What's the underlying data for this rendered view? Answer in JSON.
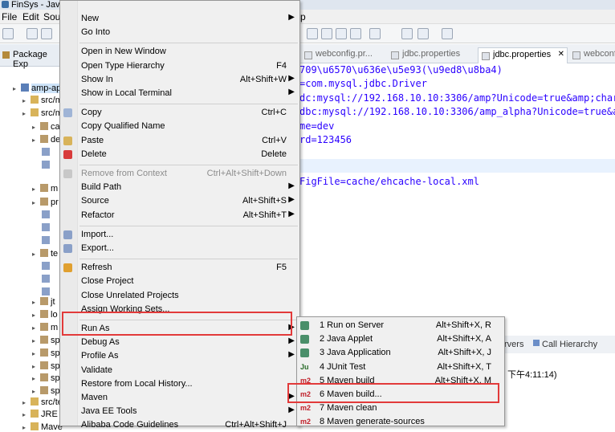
{
  "window": {
    "title": "FinSys - Java"
  },
  "menubar": {
    "file": "File",
    "edit": "Edit",
    "source": "Sou"
  },
  "package_explorer": {
    "title": "Package Exp",
    "items": [
      {
        "label": "amp-api",
        "indent": 0
      },
      {
        "label": "src/m",
        "indent": 1
      },
      {
        "label": "src/m",
        "indent": 1
      },
      {
        "label": "ca",
        "indent": 2
      },
      {
        "label": "de",
        "indent": 2
      },
      {
        "label": "",
        "indent": 3
      },
      {
        "label": "",
        "indent": 3
      },
      {
        "label": "m",
        "indent": 2
      },
      {
        "label": "pr",
        "indent": 2
      },
      {
        "label": "",
        "indent": 3
      },
      {
        "label": "",
        "indent": 3
      },
      {
        "label": "",
        "indent": 3
      },
      {
        "label": "te",
        "indent": 2
      },
      {
        "label": "",
        "indent": 3
      },
      {
        "label": "",
        "indent": 3
      },
      {
        "label": "",
        "indent": 3
      },
      {
        "label": "jt",
        "indent": 2
      },
      {
        "label": "lo",
        "indent": 2
      },
      {
        "label": "m",
        "indent": 2
      },
      {
        "label": "sp",
        "indent": 2
      },
      {
        "label": "sp",
        "indent": 2
      },
      {
        "label": "sp",
        "indent": 2
      },
      {
        "label": "sp",
        "indent": 2
      },
      {
        "label": "sp",
        "indent": 2
      },
      {
        "label": "src/te",
        "indent": 1
      },
      {
        "label": "JRE S",
        "indent": 1
      },
      {
        "label": "Mave",
        "indent": 1
      }
    ]
  },
  "editor": {
    "title_suffix": "p",
    "tabs": [
      {
        "label": "webconfig.pr...",
        "active": false
      },
      {
        "label": "jdbc.properties",
        "active": false
      },
      {
        "label": "jdbc.properties",
        "active": true,
        "close": "✕"
      },
      {
        "label": "webconfig",
        "active": false
      }
    ],
    "lines": [
      "709\\u6570\\u636e\\u5e93(\\u9ed8\\u8ba4)",
      "=com.mysql.jdbc.Driver",
      "dc:mysql://192.168.10.10:3306/amp?Unicode=true&amp;chara",
      "dbc:mysql://192.168.10.10:3306/amp_alpha?Unicode=true&am",
      "me=dev",
      "rd=123456",
      "",
      "",
      "FigFile=cache/ehcache-local.xml"
    ]
  },
  "bottom_panel": {
    "tabs": [
      "rvers",
      "Call Hierarchy"
    ],
    "timestamp": "下午4:11:14)"
  },
  "context_menu": {
    "items": [
      {
        "label": "New",
        "shortcut": "",
        "submenu": true
      },
      {
        "label": "Go Into",
        "shortcut": ""
      },
      {
        "sep": true
      },
      {
        "label": "Open in New Window",
        "shortcut": ""
      },
      {
        "label": "Open Type Hierarchy",
        "shortcut": "F4"
      },
      {
        "label": "Show In",
        "shortcut": "Alt+Shift+W",
        "submenu": true
      },
      {
        "label": "Show in Local Terminal",
        "shortcut": "",
        "submenu": true
      },
      {
        "sep": true
      },
      {
        "label": "Copy",
        "shortcut": "Ctrl+C",
        "icon": "copy-icon"
      },
      {
        "label": "Copy Qualified Name",
        "shortcut": ""
      },
      {
        "label": "Paste",
        "shortcut": "Ctrl+V",
        "icon": "paste-icon"
      },
      {
        "label": "Delete",
        "shortcut": "Delete",
        "icon": "delete-icon"
      },
      {
        "sep": true
      },
      {
        "label": "Remove from Context",
        "shortcut": "Ctrl+Alt+Shift+Down",
        "disabled": true,
        "icon": "remove-context-icon"
      },
      {
        "label": "Build Path",
        "shortcut": "",
        "submenu": true
      },
      {
        "label": "Source",
        "shortcut": "Alt+Shift+S",
        "submenu": true
      },
      {
        "label": "Refactor",
        "shortcut": "Alt+Shift+T",
        "submenu": true
      },
      {
        "sep": true
      },
      {
        "label": "Import...",
        "shortcut": "",
        "icon": "import-icon"
      },
      {
        "label": "Export...",
        "shortcut": "",
        "icon": "export-icon"
      },
      {
        "sep": true
      },
      {
        "label": "Refresh",
        "shortcut": "F5",
        "icon": "refresh-icon"
      },
      {
        "label": "Close Project",
        "shortcut": ""
      },
      {
        "label": "Close Unrelated Projects",
        "shortcut": ""
      },
      {
        "label": "Assign Working Sets...",
        "shortcut": ""
      },
      {
        "sep": true
      },
      {
        "label": "Run As",
        "shortcut": "",
        "submenu": true,
        "highlight": true
      },
      {
        "label": "Debug As",
        "shortcut": "",
        "submenu": true
      },
      {
        "label": "Profile As",
        "shortcut": "",
        "submenu": true
      },
      {
        "label": "Validate",
        "shortcut": ""
      },
      {
        "label": "Restore from Local History...",
        "shortcut": ""
      },
      {
        "label": "Maven",
        "shortcut": "",
        "submenu": true
      },
      {
        "label": "Java EE Tools",
        "shortcut": "",
        "submenu": true
      },
      {
        "label": "Alibaba Code Guidelines",
        "shortcut": "Ctrl+Alt+Shift+J"
      }
    ]
  },
  "run_as_submenu": {
    "items": [
      {
        "label": "1 Run on Server",
        "shortcut": "Alt+Shift+X, R",
        "icon": "server-icon"
      },
      {
        "label": "2 Java Applet",
        "shortcut": "Alt+Shift+X, A",
        "icon": "applet-icon"
      },
      {
        "label": "3 Java Application",
        "shortcut": "Alt+Shift+X, J",
        "icon": "java-app-icon"
      },
      {
        "label": "4 JUnit Test",
        "shortcut": "Alt+Shift+X, T",
        "icon": "junit-icon",
        "badge": "Ju"
      },
      {
        "label": "5 Maven build",
        "shortcut": "Alt+Shift+X, M",
        "icon": "maven-icon",
        "badge": "m2"
      },
      {
        "label": "6 Maven build...",
        "shortcut": "",
        "icon": "maven-icon",
        "badge": "m2",
        "highlight": true
      },
      {
        "label": "7 Maven clean",
        "shortcut": "",
        "icon": "maven-icon",
        "badge": "m2"
      },
      {
        "label": "8 Maven generate-sources",
        "shortcut": "",
        "icon": "maven-icon",
        "badge": "m2"
      }
    ]
  },
  "colors": {
    "highlight_box": "#e23a3a",
    "string": "#2a00ff",
    "menu_bg": "#f0f0f0"
  }
}
